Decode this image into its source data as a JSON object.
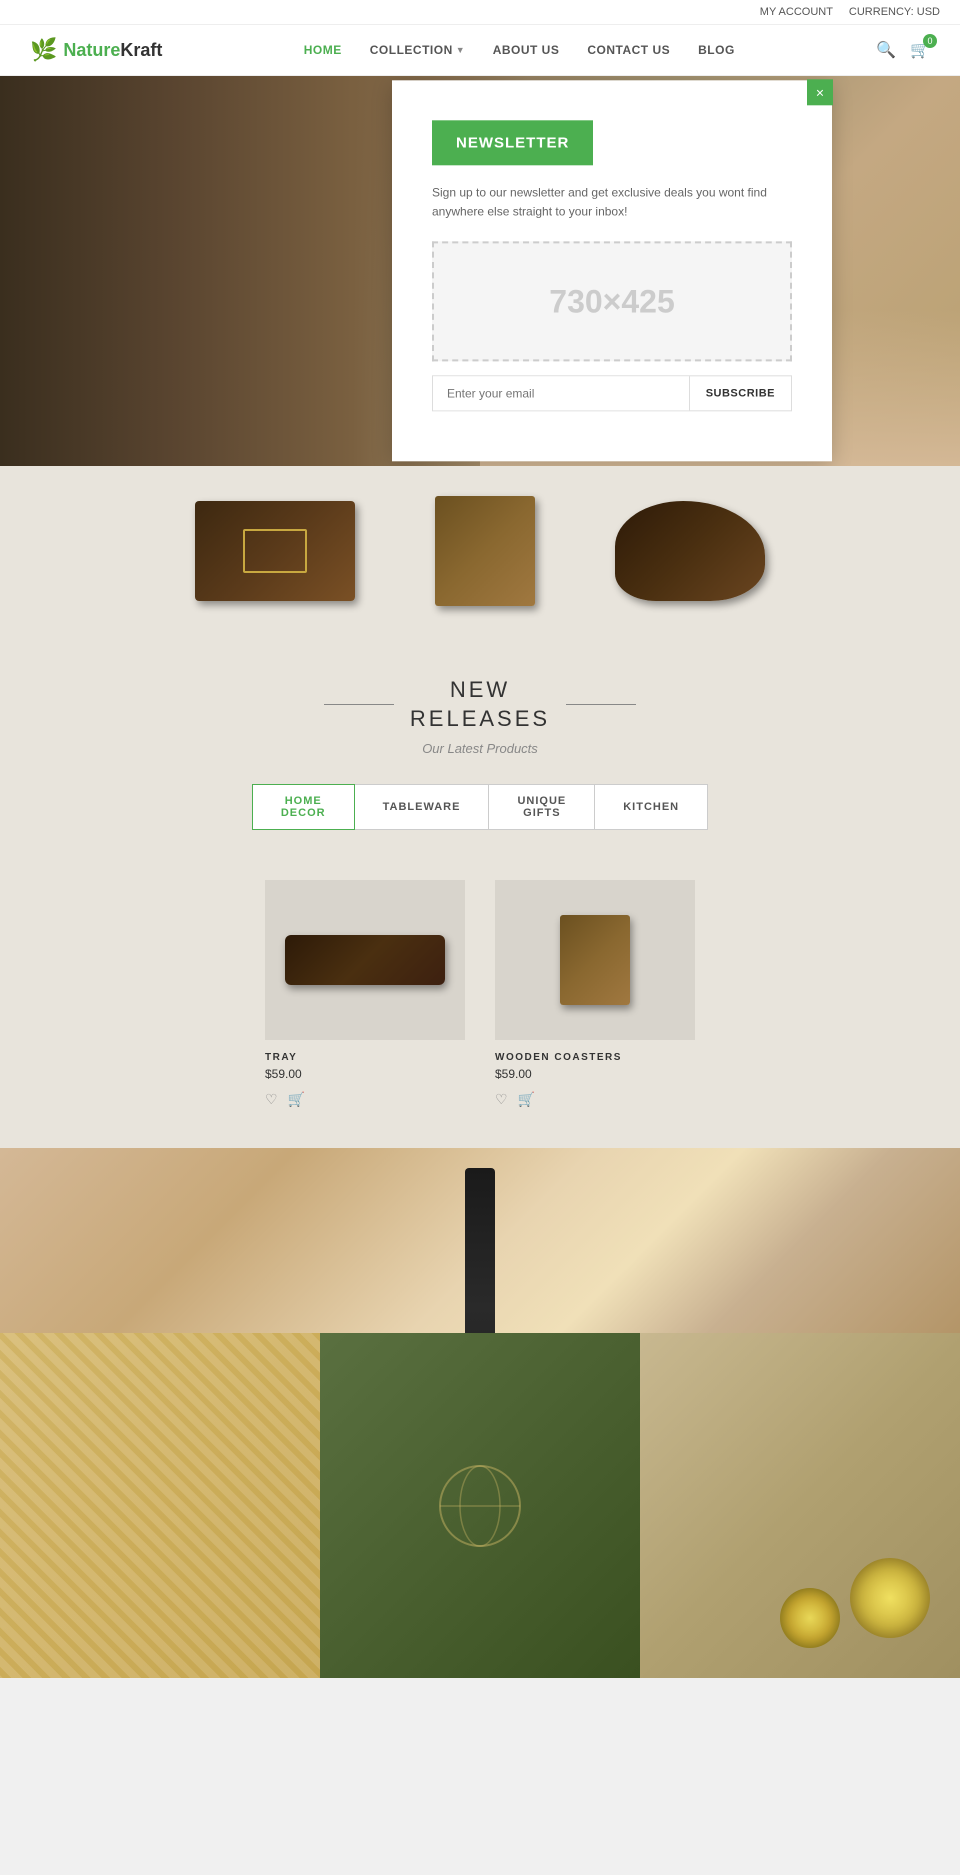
{
  "topbar": {
    "my_account": "MY ACCOUNT",
    "currency": "CURRENCY: USD"
  },
  "header": {
    "logo_name": "NatureKraft",
    "logo_green": "Nature",
    "logo_dark": "Kraft",
    "nav": {
      "home": "HOME",
      "collection": "COLLECTION",
      "about": "ABOUT US",
      "contact": "CONTACT US",
      "blog": "BLOG"
    },
    "cart_count": "0"
  },
  "newsletter": {
    "btn_label": "NEWSLETTER",
    "description": "Sign up to our newsletter and get exclusive deals you wont find anywhere else straight to your inbox!",
    "placeholder_text": "730×425",
    "email_placeholder": "Enter your email",
    "subscribe_label": "SUBSCRIBE",
    "close_label": "×"
  },
  "new_releases": {
    "title_line1": "NEW",
    "title_line2": "RELEASES",
    "subtitle": "Our Latest Products",
    "categories": [
      {
        "label": "HOME DECOR",
        "active": true
      },
      {
        "label": "TABLEWARE",
        "active": false
      },
      {
        "label": "UNIQUE GIFTS",
        "active": false
      },
      {
        "label": "KITCHEN",
        "active": false
      }
    ],
    "products": [
      {
        "name": "TRAY",
        "price": "$59.00",
        "type": "tray"
      },
      {
        "name": "WOODEN COASTERS",
        "price": "$59.00",
        "type": "coasters"
      }
    ]
  },
  "product_band": {
    "items": [
      {
        "type": "wood-box",
        "alt": "Wooden box with elephant motif"
      },
      {
        "type": "corner-piece",
        "alt": "Decorative corner piece"
      },
      {
        "type": "duck",
        "alt": "Wooden duck figurine"
      }
    ]
  }
}
